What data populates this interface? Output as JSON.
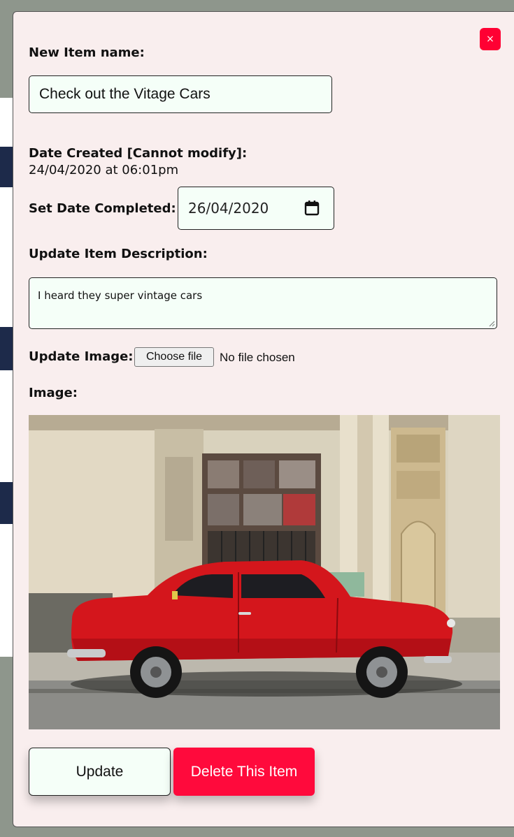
{
  "modal": {
    "close_label": "×",
    "item_name": {
      "label": "New Item name:",
      "value": "Check out the Vitage Cars"
    },
    "date_created": {
      "label": "Date Created [Cannot modify]:",
      "value": "24/04/2020 at 06:01pm"
    },
    "date_completed": {
      "label": "Set Date Completed:",
      "value": "26/04/2020"
    },
    "description": {
      "label": "Update Item Description:",
      "value": "I heard they super vintage cars"
    },
    "update_image": {
      "label": "Update Image:",
      "button": "Choose file",
      "status": "No file chosen"
    },
    "image": {
      "label": "Image:"
    },
    "buttons": {
      "update": "Update",
      "delete": "Delete This Item"
    }
  },
  "colors": {
    "accent_red": "#ff0a3c",
    "modal_bg": "#f9eeee",
    "input_bg": "#f5fff8"
  }
}
